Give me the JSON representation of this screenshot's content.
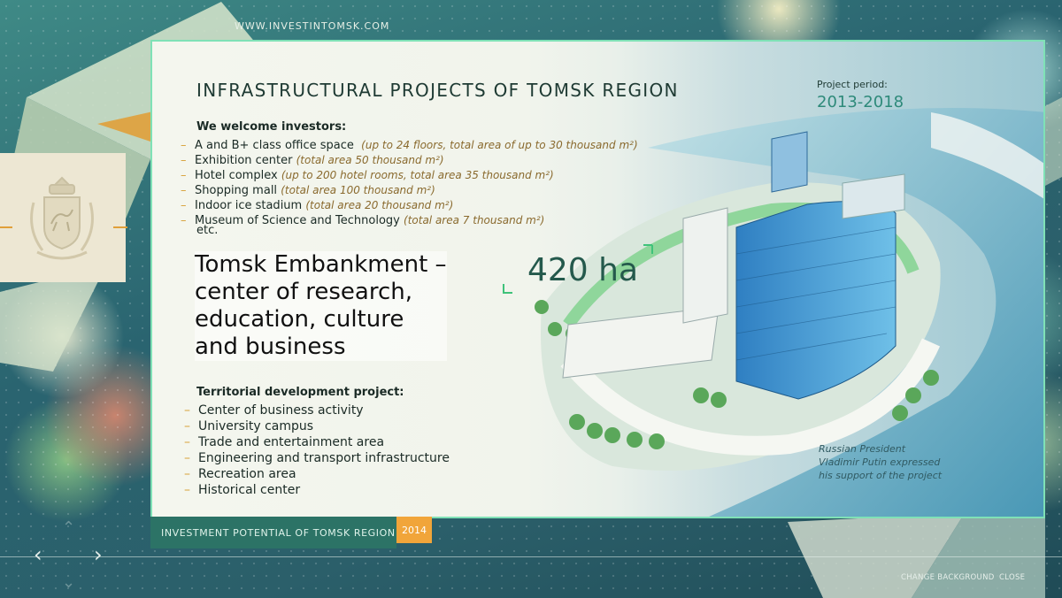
{
  "site_url": "WWW.INVESTINTOMSK.COM",
  "slide": {
    "title": "INFRASTRUCTURAL PROJECTS OF TOMSK REGION",
    "period_label": "Project period:",
    "period_value": "2013-2018",
    "investors_heading": "We welcome investors:",
    "investor_items": [
      {
        "label": "A and B+ class office space",
        "note": "(up to 24 floors, total area of up to 30 thousand m²)"
      },
      {
        "label": "Exhibition center",
        "note": "(total area 50 thousand m²)"
      },
      {
        "label": "Hotel complex",
        "note": "(up to 200 hotel rooms, total area 35 thousand m²)"
      },
      {
        "label": "Shopping mall",
        "note": "(total area 100 thousand m²)"
      },
      {
        "label": "Indoor ice stadium",
        "note": "(total area 20 thousand m²)"
      },
      {
        "label": "Museum of Science and Technology",
        "note": "(total area 7 thousand m²)"
      }
    ],
    "etc": "etc.",
    "headline_lines": [
      "Tomsk Embankment –",
      "center of research,",
      "education, culture",
      "and business"
    ],
    "area": "420 ha",
    "territorial_heading": "Territorial development project:",
    "territorial_items": [
      "Center of business activity",
      "University campus",
      "Trade and entertainment area",
      "Engineering and transport infrastructure",
      "Recreation area",
      "Historical center"
    ],
    "caption_lines": [
      "Russian President",
      "Vladimir Putin expressed",
      "his support of the project"
    ]
  },
  "footer": {
    "section_label": "INVESTMENT POTENTIAL OF TOMSK REGION",
    "year": "2014",
    "change_background": "CHANGE BACKGROUND",
    "close": "CLOSE"
  },
  "nav": {
    "prev_icon": "‹",
    "next_icon": "›",
    "up_icon": "⌃",
    "down_icon": "⌄"
  },
  "colors": {
    "accent_green": "#7fe1b6",
    "accent_orange": "#f1a53a",
    "footer_bar": "#2c7366",
    "dash": "#d8a23a"
  }
}
